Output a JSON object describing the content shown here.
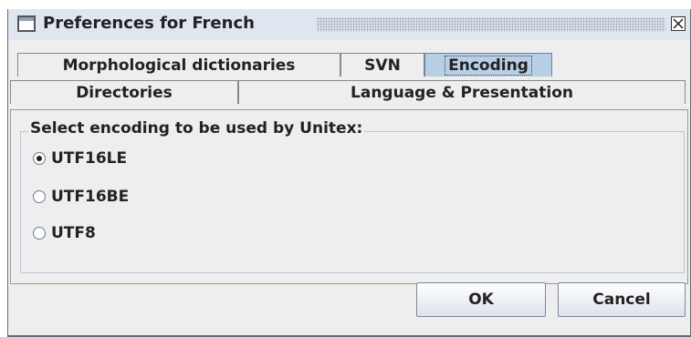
{
  "window": {
    "title": "Preferences for French"
  },
  "tabs": {
    "row1": [
      {
        "label": "Morphological dictionaries"
      },
      {
        "label": "SVN"
      },
      {
        "label": "Encoding",
        "selected": true
      }
    ],
    "row2": [
      {
        "label": "Directories"
      },
      {
        "label": "Language & Presentation"
      }
    ]
  },
  "encoding": {
    "group_label": "Select encoding to be used by Unitex:",
    "options": [
      {
        "label": "UTF16LE",
        "checked": true
      },
      {
        "label": "UTF16BE",
        "checked": false
      },
      {
        "label": "UTF8",
        "checked": false
      }
    ]
  },
  "buttons": {
    "ok": "OK",
    "cancel": "Cancel"
  }
}
